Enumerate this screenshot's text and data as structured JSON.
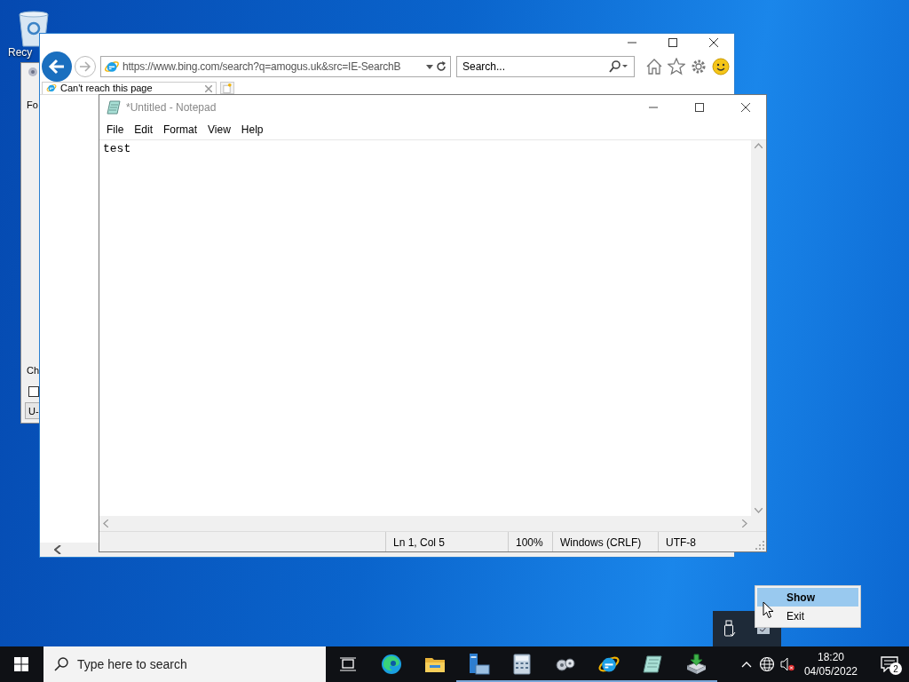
{
  "desktop": {
    "icons": [
      {
        "label": "Recy"
      }
    ]
  },
  "back_window": {
    "texts": [
      "Fo",
      "Ch"
    ],
    "checkbox": {
      "checked": false
    },
    "combo_value": "U-"
  },
  "browser": {
    "address": "https://www.bing.com/search?q=amogus.uk&src=IE-SearchB",
    "search": {
      "placeholder": "Search..."
    },
    "tabs": [
      {
        "label": "Can't reach this page",
        "selected": true
      }
    ]
  },
  "notepad": {
    "title": "*Untitled - Notepad",
    "menu": [
      "File",
      "Edit",
      "Format",
      "View",
      "Help"
    ],
    "content": "test",
    "status_bar": [
      "Ln 1, Col 5",
      "100%",
      "Windows (CRLF)",
      "UTF-8"
    ]
  },
  "context_menu": {
    "items": [
      {
        "label": "Show",
        "selected": true,
        "default": true
      },
      {
        "label": "Exit",
        "selected": false,
        "default": false
      }
    ]
  },
  "taskbar": {
    "search": {
      "placeholder": "Type here to search"
    },
    "apps": [
      {
        "kind": "task-view",
        "running": false
      },
      {
        "kind": "edge",
        "running": false
      },
      {
        "kind": "explorer",
        "running": false
      },
      {
        "kind": "server",
        "running": true
      },
      {
        "kind": "calculator",
        "running": true
      },
      {
        "kind": "tool",
        "running": true
      },
      {
        "kind": "ie",
        "running": true
      },
      {
        "kind": "notepad",
        "running": true
      },
      {
        "kind": "installer",
        "running": true
      }
    ],
    "clock": {
      "time": "18:20",
      "date": "04/05/2022"
    },
    "notifications": {
      "count": "2"
    }
  }
}
